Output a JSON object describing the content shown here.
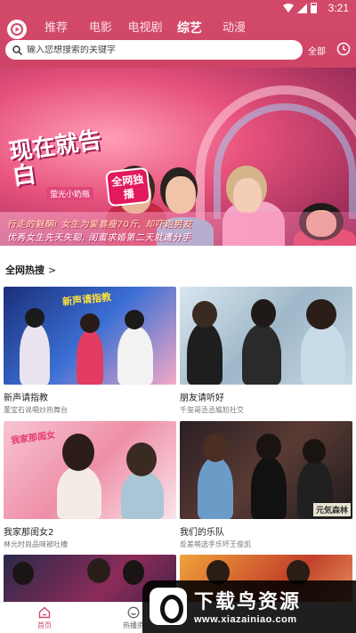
{
  "status_bar": {
    "time": "3:21",
    "icons": [
      "wifi-icon",
      "signal-icon",
      "battery-icon"
    ]
  },
  "header": {
    "tabs": [
      {
        "label": "推荐",
        "active": false
      },
      {
        "label": "电影",
        "active": false
      },
      {
        "label": "电视剧",
        "active": false
      },
      {
        "label": "综艺",
        "active": true
      },
      {
        "label": "动漫",
        "active": false
      }
    ],
    "search_placeholder": "输入您想搜索的关键字",
    "all_label": "全部"
  },
  "banner": {
    "title": "现在就告白",
    "subtitle": "萤光小奶瓶",
    "badge": "全网独播",
    "caption_line1": "行走的魅酮! 女生为爱暴瘦70斤, 却吓跑男友",
    "caption_line2": "优秀女生先天失聪, 闺蜜求婚第二天就遭分手"
  },
  "section": {
    "title": "全网热搜",
    "arrow": ">"
  },
  "cards": [
    {
      "title": "新声请指教",
      "desc": "董宝石说唱炒热舞台",
      "tag": "新声请指教"
    },
    {
      "title": "朋友请听好",
      "desc": "千玺哥丞丞尴尬社交",
      "tag": ""
    },
    {
      "title": "我家那闺女2",
      "desc": "林允时尚品味被吐槽",
      "tag": "我家那闺女"
    },
    {
      "title": "我们的乐队",
      "desc": "反差萌选手乐坏王俊凯",
      "tag": "元気森林"
    },
    {
      "title": "",
      "desc": "",
      "tag": ""
    },
    {
      "title": "",
      "desc": "",
      "tag": ""
    }
  ],
  "bottom_nav": [
    {
      "label": "首页",
      "icon": "home-icon",
      "active": true
    },
    {
      "label": "热播资",
      "icon": "smile-icon",
      "active": false
    }
  ],
  "watermark": {
    "title": "下载鸟资源",
    "url": "www.xiazainiao.com"
  },
  "colors": {
    "brand": "#d2496a",
    "active_nav": "#d2496a"
  }
}
